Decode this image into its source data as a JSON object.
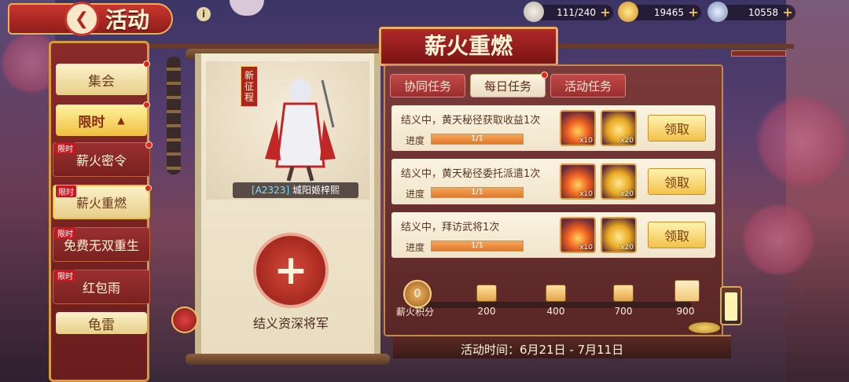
{
  "header": {
    "title": "活动",
    "back_glyph": "❮",
    "info_glyph": "i"
  },
  "resources": [
    {
      "name": "stamina",
      "value": "111/240"
    },
    {
      "name": "gold-ingot",
      "value": "19465"
    },
    {
      "name": "silver-coin",
      "value": "10558"
    }
  ],
  "menu": {
    "gather": "集会",
    "limited": "限时",
    "limited_arrow": "▲",
    "tag": "限时",
    "items": [
      {
        "label": "薪火密令"
      },
      {
        "label": "薪火重燃"
      },
      {
        "label": "免费无双重生"
      },
      {
        "label": "红包雨"
      },
      {
        "label": "龟雷"
      }
    ]
  },
  "hero": {
    "tag": "新征程",
    "code": "[A2323]",
    "name": "城阳姬梓熙",
    "slot_plus": "+",
    "slot_label": "结义资深将军"
  },
  "event": {
    "title": "薪火重燃",
    "tabs": [
      {
        "label": "协同任务"
      },
      {
        "label": "每日任务"
      },
      {
        "label": "活动任务"
      }
    ],
    "progress_label": "进度",
    "claim_label": "领取",
    "tasks": [
      {
        "title": "结义中，黄天秘径获取收益1次",
        "progress_text": "1/1",
        "progress": 1.0,
        "reward1_qty": "x10",
        "reward2_qty": "x20"
      },
      {
        "title": "结义中，黄天秘径委托派遣1次",
        "progress_text": "1/1",
        "progress": 1.0,
        "reward1_qty": "x10",
        "reward2_qty": "x20"
      },
      {
        "title": "结义中，拜访武将1次",
        "progress_text": "1/1",
        "progress": 1.0,
        "reward1_qty": "x10",
        "reward2_qty": "x20"
      }
    ],
    "points": {
      "value": "0",
      "label": "薪火积分",
      "milestones": [
        "200",
        "400",
        "700",
        "900"
      ]
    },
    "time_text": "活动时间：6月21日 - 7月11日"
  },
  "colors": {
    "accent_red": "#b02828",
    "gold": "#f0c040",
    "panel": "#7a3a3a"
  }
}
